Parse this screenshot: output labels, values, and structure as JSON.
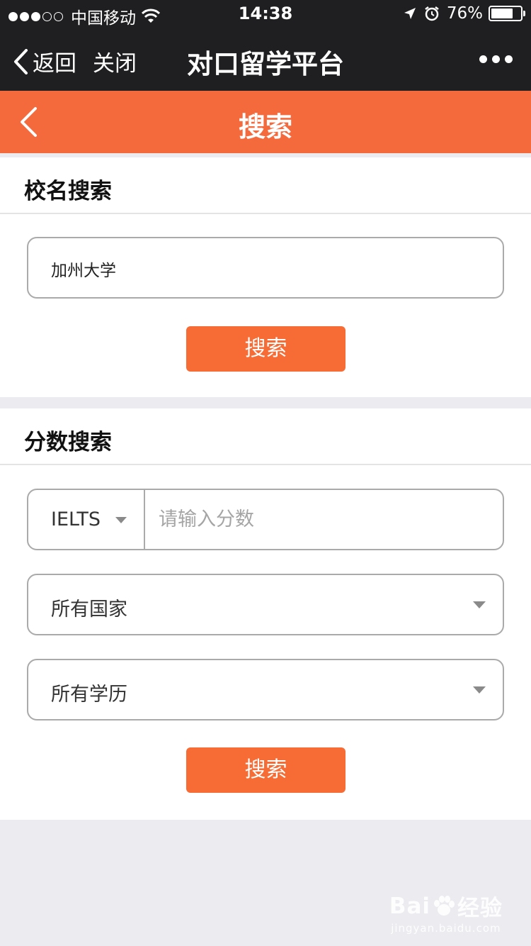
{
  "status_bar": {
    "carrier": "中国移动",
    "time": "14:38",
    "battery_percent": "76%",
    "battery_level": 0.76,
    "signal_filled": 3,
    "signal_total": 5
  },
  "wechat_bar": {
    "back_label": "返回",
    "close_label": "关闭",
    "title": "对口留学平台"
  },
  "header": {
    "title": "搜索"
  },
  "school_search": {
    "title": "校名搜索",
    "input_value": "加州大学",
    "button_label": "搜索"
  },
  "score_search": {
    "title": "分数搜索",
    "test_type": "IELTS",
    "score_placeholder": "请输入分数",
    "country_select": "所有国家",
    "degree_select": "所有学历",
    "button_label": "搜索"
  },
  "watermark": {
    "brand_left": "Bai",
    "brand_right": "经验",
    "url": "jingyan.baidu.com"
  },
  "colors": {
    "accent": "#f46a3c",
    "button": "#f76b35",
    "dark_bar": "#1f1f21",
    "background": "#ebebf0"
  }
}
